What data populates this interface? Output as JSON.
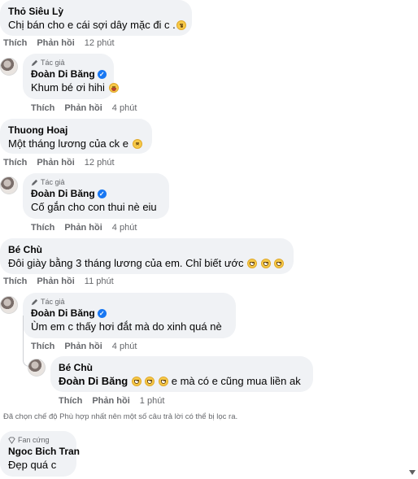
{
  "labels": {
    "like": "Thích",
    "reply": "Phản hồi",
    "author": "Tác giả",
    "fan": "Fan cứng"
  },
  "comments": [
    {
      "name": "Thỏ Siêu Lỳ",
      "text": "Chị bán cho e cái sợi dây mặc đi c .",
      "time": "12 phút"
    },
    {
      "name": "Đoàn Di Băng",
      "text": "Khum bé ơi hihi",
      "time": "4 phút"
    },
    {
      "name": "Thuong Hoaj",
      "text": "Một tháng lương của ck e",
      "time": "12 phút"
    },
    {
      "name": "Đoàn Di Băng",
      "text": "Cố gắn cho con thui nè eiu",
      "time": "4 phút"
    },
    {
      "name": "Bé Chù",
      "text": "Đôi giày bằng 3 tháng lương của em. Chỉ biết ước",
      "time": "11 phút"
    },
    {
      "name": "Đoàn Di Băng",
      "text": "Ùm em c thấy hơi đắt mà do xinh quá nè",
      "time": "4 phút"
    },
    {
      "name": "Bé Chù",
      "mention": "Đoàn Di Băng",
      "text": "e mà có e cũng mua liền ak",
      "time": "1 phút"
    },
    {
      "name": "Ngoc Bich Tran",
      "text": "Đẹp quá c"
    }
  ],
  "notice": "Đã chọn chế độ Phù hợp nhất nên một số câu trả lời có thể bị lọc ra.",
  "colors": {
    "bubble": "#f0f2f5",
    "meta": "#65676b",
    "verified": "#1877f2"
  }
}
